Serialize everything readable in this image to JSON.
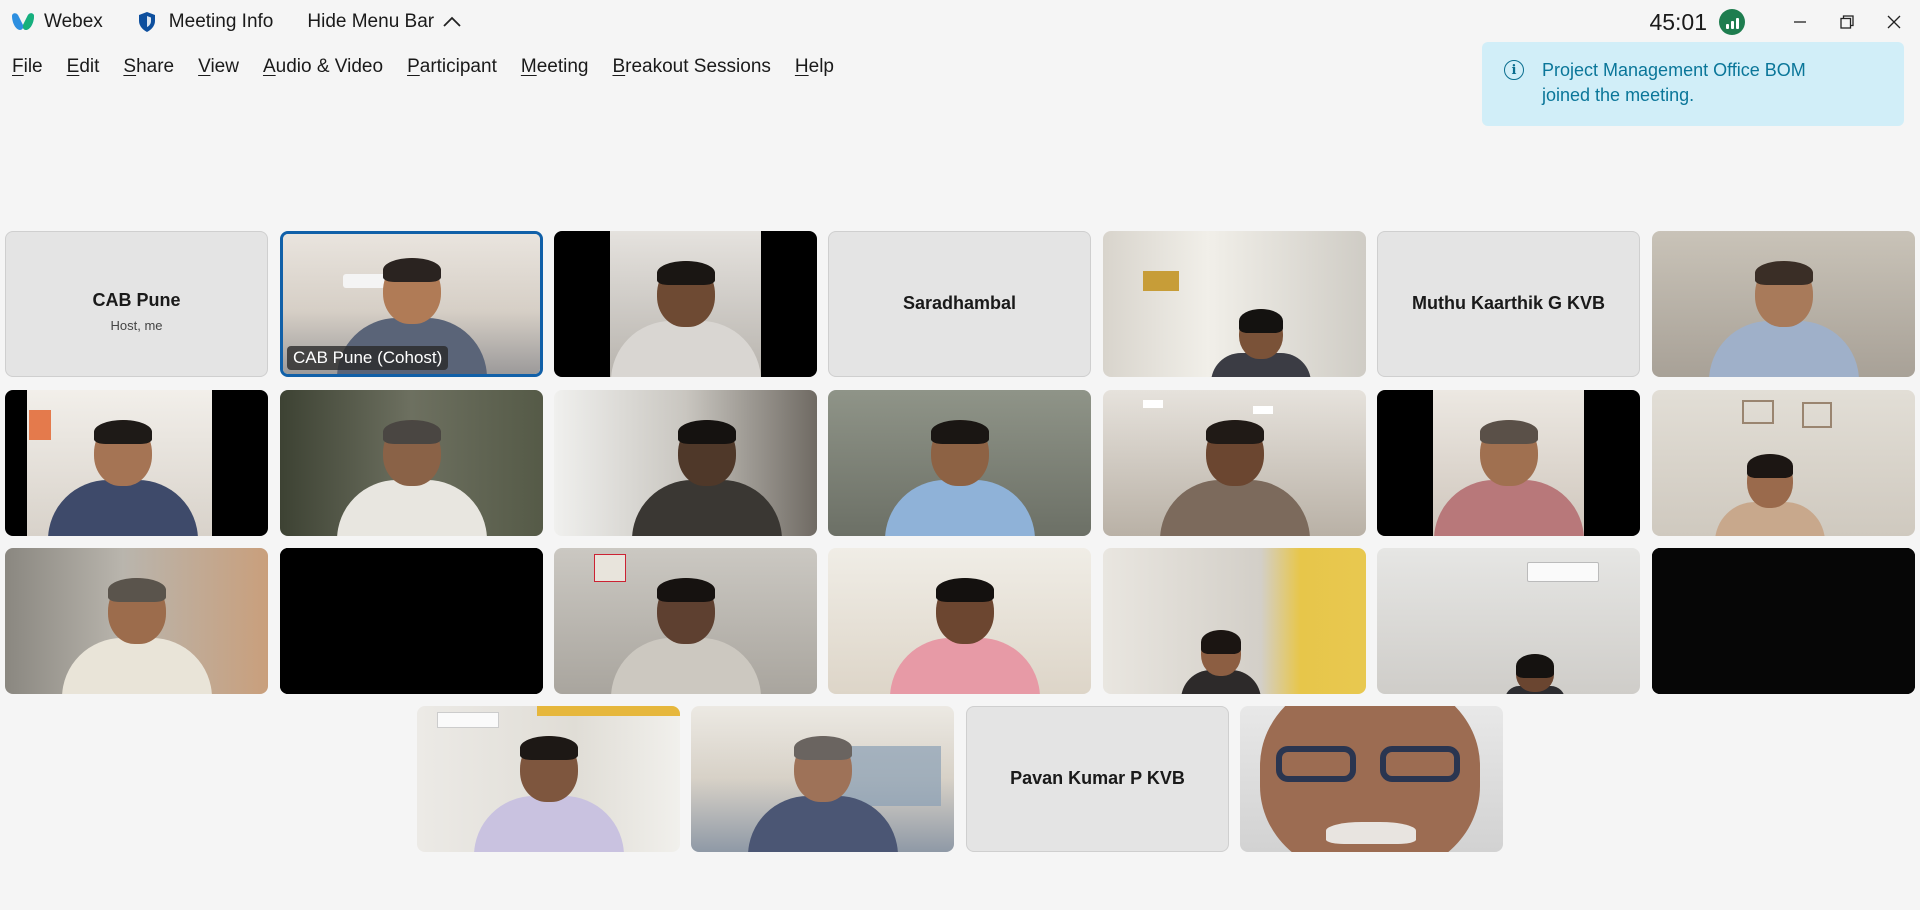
{
  "titlebar": {
    "app_name": "Webex",
    "meeting_info": "Meeting Info",
    "hide_menu": "Hide Menu Bar",
    "timer": "45:01"
  },
  "menu": [
    {
      "accel": "F",
      "rest": "ile"
    },
    {
      "accel": "E",
      "rest": "dit"
    },
    {
      "accel": "S",
      "rest": "hare"
    },
    {
      "accel": "V",
      "rest": "iew"
    },
    {
      "accel": "A",
      "rest": "udio & Video"
    },
    {
      "accel": "P",
      "rest": "articipant"
    },
    {
      "accel": "M",
      "rest": "eeting"
    },
    {
      "accel": "B",
      "rest": "reakout Sessions"
    },
    {
      "accel": "H",
      "rest": "elp"
    }
  ],
  "toast": {
    "message": "Project Management Office BOM joined the meeting."
  },
  "participants": {
    "p1_name": "CAB Pune",
    "p1_sub": "Host, me",
    "p2_label": "CAB Pune (Cohost)",
    "p4_name": "Saradhambal",
    "p6_name": "Muthu Kaarthik G KVB",
    "p24_name": "Pavan Kumar P KVB"
  },
  "colors": {
    "toast_bg": "#d1eef8",
    "toast_text": "#0a7699",
    "active_border": "#1160a8",
    "signal_green": "#1e7d4f"
  }
}
